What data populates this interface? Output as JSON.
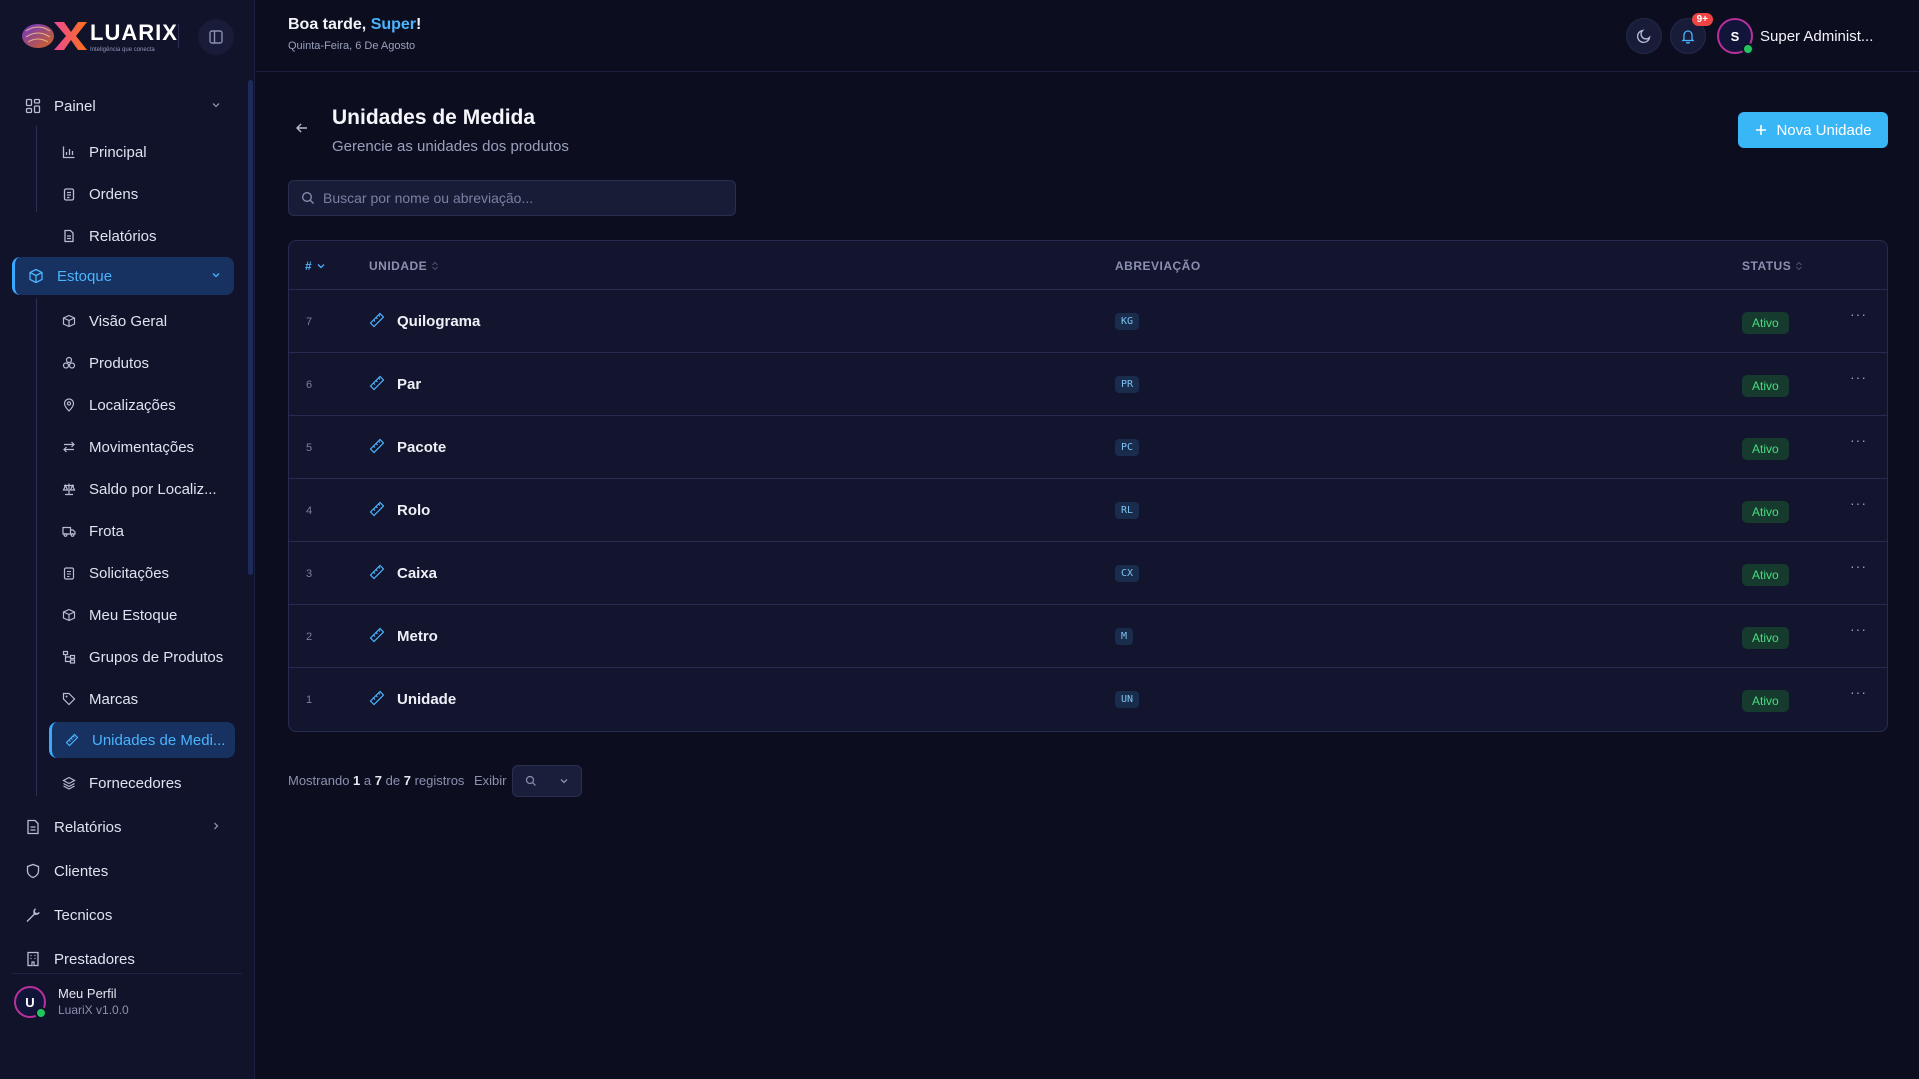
{
  "app": {
    "brand": "LUARIX",
    "tagline": "Inteligência que conecta"
  },
  "header": {
    "greeting_prefix": "Boa tarde, ",
    "greeting_name": "Super",
    "greeting_suffix": "!",
    "date": "Quinta-Feira, 6 De Agosto",
    "notification_badge": "9+",
    "user_initial": "S",
    "user_name": "Super Administ..."
  },
  "sidebar": {
    "sections": [
      {
        "label": "Painel",
        "icon": "dashboard-icon",
        "expanded": true
      },
      {
        "label": "Estoque",
        "icon": "box-icon",
        "expanded": true,
        "active": true
      },
      {
        "label": "Relatórios",
        "icon": "document-icon",
        "expanded": false
      },
      {
        "label": "Clientes",
        "icon": "shield-icon"
      },
      {
        "label": "Tecnicos",
        "icon": "wrench-icon"
      },
      {
        "label": "Prestadores",
        "icon": "building-icon"
      }
    ],
    "painel_items": [
      {
        "label": "Principal",
        "icon": "bar-chart-icon"
      },
      {
        "label": "Ordens",
        "icon": "clipboard-icon"
      },
      {
        "label": "Relatórios",
        "icon": "document-icon"
      }
    ],
    "estoque_items": [
      {
        "label": "Visão Geral",
        "icon": "box-icon"
      },
      {
        "label": "Produtos",
        "icon": "boxes-icon"
      },
      {
        "label": "Localizações",
        "icon": "map-pin-icon"
      },
      {
        "label": "Movimentações",
        "icon": "arrows-icon"
      },
      {
        "label": "Saldo por Localiz...",
        "icon": "scale-icon"
      },
      {
        "label": "Frota",
        "icon": "truck-icon"
      },
      {
        "label": "Solicitações",
        "icon": "clipboard-icon"
      },
      {
        "label": "Meu Estoque",
        "icon": "box-icon"
      },
      {
        "label": "Grupos de Produtos",
        "icon": "tree-icon"
      },
      {
        "label": "Marcas",
        "icon": "tag-icon"
      },
      {
        "label": "Unidades de Medi...",
        "icon": "ruler-icon",
        "active": true
      },
      {
        "label": "Fornecedores",
        "icon": "layers-icon"
      }
    ],
    "profile": {
      "initial": "U",
      "name": "Meu Perfil",
      "version": "LuariX v1.0.0"
    }
  },
  "page": {
    "title": "Unidades de Medida",
    "subtitle": "Gerencie as unidades dos produtos",
    "new_button": "Nova Unidade",
    "search_placeholder": "Buscar por nome ou abreviação..."
  },
  "table": {
    "columns": {
      "id": "#",
      "name": "UNIDADE",
      "abbr": "ABREVIAÇÃO",
      "status": "STATUS"
    },
    "rows": [
      {
        "id": "7",
        "name": "Quilograma",
        "abbr": "KG",
        "status": "Ativo"
      },
      {
        "id": "6",
        "name": "Par",
        "abbr": "PR",
        "status": "Ativo"
      },
      {
        "id": "5",
        "name": "Pacote",
        "abbr": "PC",
        "status": "Ativo"
      },
      {
        "id": "4",
        "name": "Rolo",
        "abbr": "RL",
        "status": "Ativo"
      },
      {
        "id": "3",
        "name": "Caixa",
        "abbr": "CX",
        "status": "Ativo"
      },
      {
        "id": "2",
        "name": "Metro",
        "abbr": "M",
        "status": "Ativo"
      },
      {
        "id": "1",
        "name": "Unidade",
        "abbr": "UN",
        "status": "Ativo"
      }
    ]
  },
  "footer": {
    "showing": "Mostrando",
    "from": "1",
    "to_word": "a",
    "to": "7",
    "of_word": "de",
    "total": "7",
    "records_word": "registros",
    "per_page_label": "Exibir"
  },
  "colors": {
    "accent": "#38b6f5",
    "background": "#0c0e20",
    "sidebar": "#101329",
    "status_active": "#4ade80",
    "badge": "#ef4444"
  }
}
